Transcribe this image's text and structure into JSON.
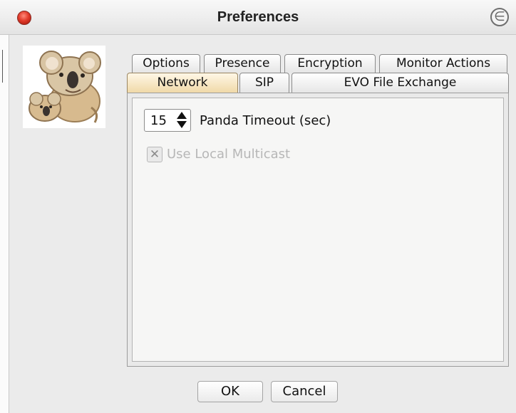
{
  "window": {
    "title": "Preferences",
    "close_icon": "close-icon",
    "corner_icon": "e-icon"
  },
  "logo": {
    "icon": "koala-logo-icon"
  },
  "tabs": {
    "row1": [
      {
        "label": "Options"
      },
      {
        "label": "Presence"
      },
      {
        "label": "Encryption"
      },
      {
        "label": "Monitor Actions"
      }
    ],
    "row2": [
      {
        "label": "Network",
        "selected": true
      },
      {
        "label": "SIP"
      },
      {
        "label": "EVO File Exchange"
      }
    ]
  },
  "network": {
    "panda_timeout": {
      "value": "15",
      "label": "Panda Timeout (sec)"
    },
    "local_multicast": {
      "label": "Use Local Multicast",
      "checked": true,
      "enabled": false
    }
  },
  "buttons": {
    "ok": "OK",
    "cancel": "Cancel"
  },
  "colors": {
    "selected_tab": "#f0d9a8",
    "close_button": "#e23b2b"
  }
}
